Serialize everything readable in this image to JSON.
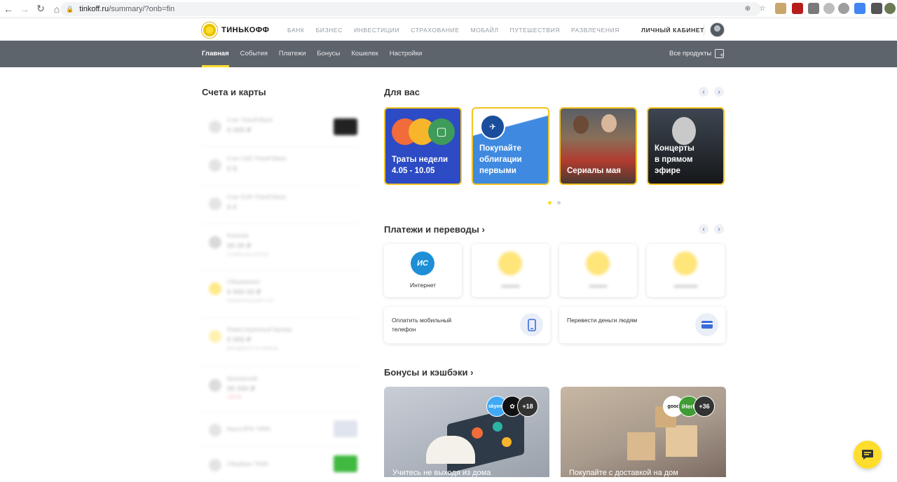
{
  "browser": {
    "url_host": "tinkoff.ru",
    "url_path": "/summary/?onb=fin"
  },
  "header": {
    "logo_text": "ТИНЬКОФФ",
    "nav": [
      "БАНК",
      "БИЗНЕС",
      "ИНВЕСТИЦИИ",
      "СТРАХОВАНИЕ",
      "МОБАЙЛ",
      "ПУТЕШЕСТВИЯ",
      "РАЗВЛЕЧЕНИЯ"
    ],
    "cabinet": "ЛИЧНЫЙ КАБИНЕТ"
  },
  "subnav": {
    "tabs": [
      "Главная",
      "События",
      "Платежи",
      "Бонусы",
      "Кошелек",
      "Настройки"
    ],
    "active": "Главная",
    "all_products": "Все продукты"
  },
  "accounts": {
    "title": "Счета и карты"
  },
  "for_you": {
    "title": "Для вас",
    "stories": [
      {
        "caption": "Траты недели",
        "caption2": "4.05 - 10.05"
      },
      {
        "caption": "Покупайте",
        "caption2": "облигации",
        "caption3": "первыми"
      },
      {
        "caption": "Сериалы мая"
      },
      {
        "caption": "Концерты",
        "caption2": "в прямом",
        "caption3": "эфире"
      }
    ]
  },
  "payments": {
    "title": "Платежи и переводы",
    "tiles": [
      {
        "label": "Интернет",
        "icon": "internet-provider-icon"
      },
      {
        "label": "",
        "icon": "placeholder-icon"
      },
      {
        "label": "",
        "icon": "placeholder-icon"
      },
      {
        "label": "",
        "icon": "placeholder-icon"
      }
    ],
    "wide": [
      {
        "label": "Оплатить мобильный телефон",
        "icon": "phone-icon"
      },
      {
        "label": "Перевести деньги людям",
        "icon": "card-icon"
      }
    ]
  },
  "bonuses": {
    "title": "Бонусы и кэшбэки",
    "cards": [
      {
        "caption": "Учитесь не выходя из дома",
        "count": "+18",
        "badge1": "skyeng"
      },
      {
        "caption": "Покупайте с доставкой на дом",
        "count": "+36",
        "badge1": "good",
        "badge2": "iHerb"
      }
    ]
  },
  "colors": {
    "brand_yellow": "#ffdd2d",
    "subnav_bg": "#5e646c",
    "accent_blue": "#3c6bdc"
  }
}
